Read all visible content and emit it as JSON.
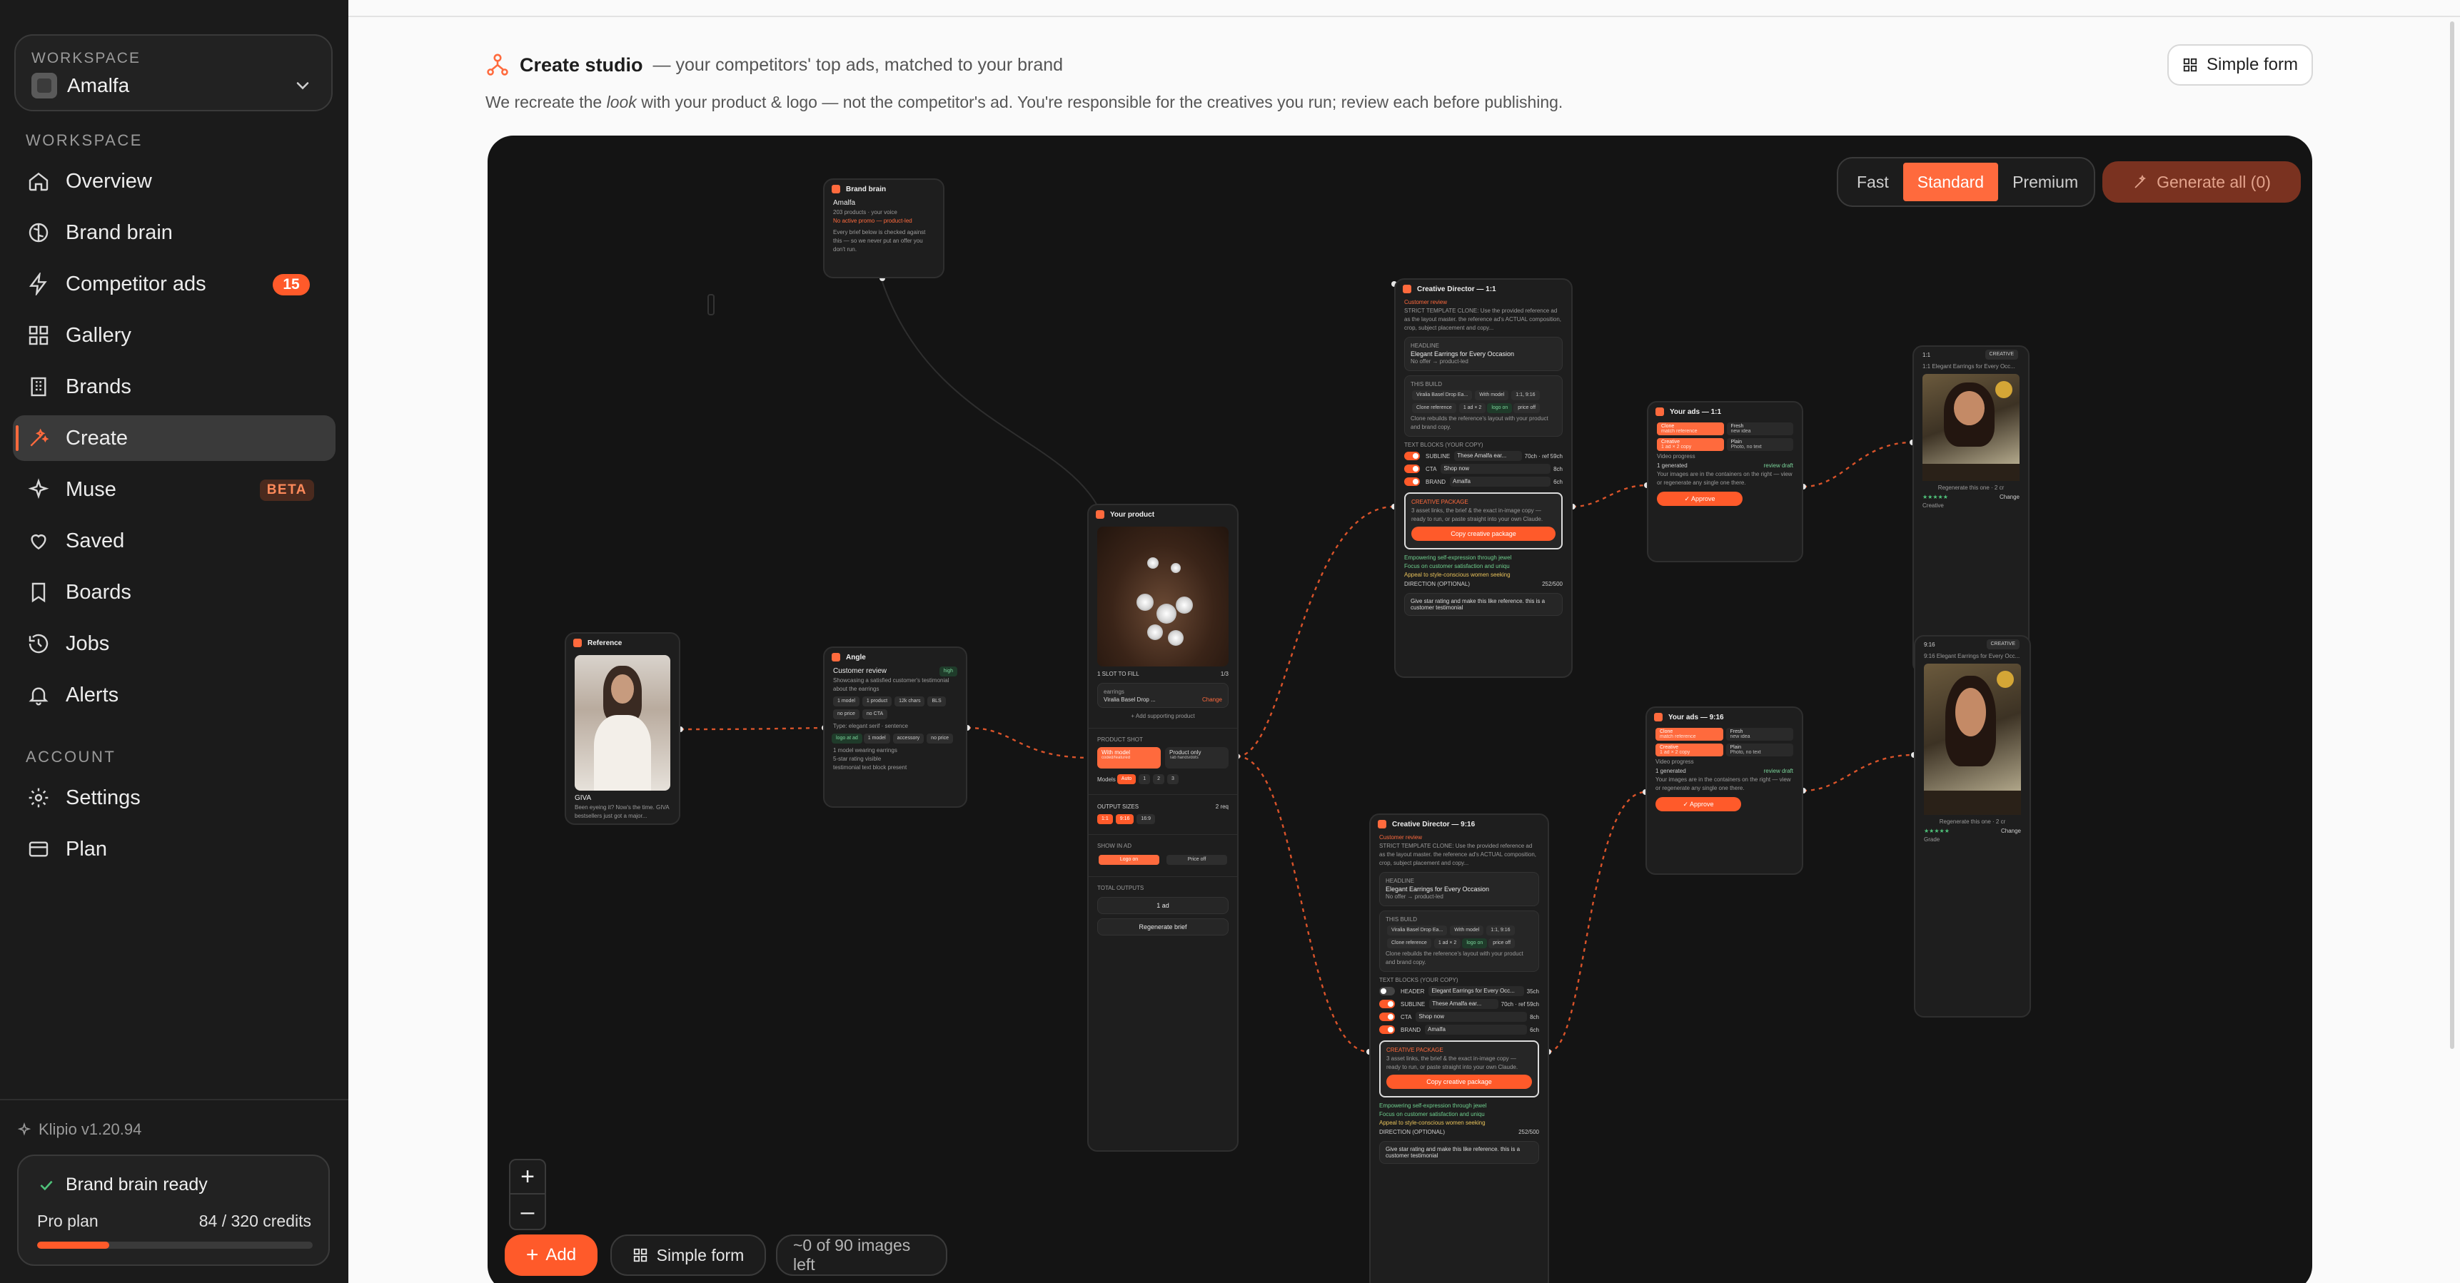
{
  "sidebar": {
    "workspace_caption": "WORKSPACE",
    "workspace_name": "Amalfa",
    "section_workspace": "WORKSPACE",
    "section_account": "ACCOUNT",
    "items": [
      {
        "label": "Overview",
        "icon": "home-icon"
      },
      {
        "label": "Brand brain",
        "icon": "brain-icon"
      },
      {
        "label": "Competitor ads",
        "icon": "bolt-icon",
        "count": "15"
      },
      {
        "label": "Gallery",
        "icon": "grid-icon"
      },
      {
        "label": "Brands",
        "icon": "building-icon"
      },
      {
        "label": "Create",
        "icon": "wand-icon",
        "active": true
      },
      {
        "label": "Muse",
        "icon": "sparkle-icon",
        "badge": "BETA"
      },
      {
        "label": "Saved",
        "icon": "heart-icon"
      },
      {
        "label": "Boards",
        "icon": "bookmark-icon"
      },
      {
        "label": "Jobs",
        "icon": "history-icon"
      },
      {
        "label": "Alerts",
        "icon": "bell-icon"
      }
    ],
    "account_items": [
      {
        "label": "Settings",
        "icon": "gear-icon"
      },
      {
        "label": "Plan",
        "icon": "card-icon"
      }
    ],
    "version": "Klipio v1.20.94",
    "status": "Brand brain ready",
    "plan": "Pro plan",
    "credits": "84 / 320 credits",
    "credits_used_fraction": 0.2625
  },
  "header": {
    "title": "Create studio",
    "subtitle": "— your competitors' top ads, matched to your brand",
    "desc_before": "We recreate the ",
    "desc_em": "look",
    "desc_after": " with your product & logo — not the competitor's ad. You're responsible for the creatives you run; review each before publishing.",
    "simple_form": "Simple form"
  },
  "canvas": {
    "tiers": [
      "Fast",
      "Standard",
      "Premium"
    ],
    "active_tier": "Standard",
    "generate_all": "Generate all (0)",
    "zoom_in": "+",
    "zoom_out": "–",
    "add": "Add",
    "simple_form": "Simple form",
    "images_left": "~0 of 90 images left"
  },
  "nodes": {
    "brand_brain": {
      "title": "Brand brain",
      "name": "Amalfa",
      "meta": "203 products · your voice",
      "warn": "No active promo — product-led",
      "body": "Every brief below is checked against this — so we never put an offer you don't run."
    },
    "reference": {
      "title": "Reference",
      "brand": "GIVA",
      "caption": "Been eyeing it? Now's the time. GIVA bestsellers just got a major..."
    },
    "angle": {
      "title": "Angle",
      "heading": "Customer review",
      "tag": "high",
      "body": "Showcasing a satisfied customer's testimonial about the earrings",
      "chips": [
        "1 model",
        "1 product",
        "12k chars",
        "BLS",
        "no price",
        "no CTA"
      ],
      "type": "Type: elegant serif · sentence",
      "chips2": [
        "logo at ad",
        "1 model",
        "accessory",
        "no price"
      ],
      "bullets": [
        "1 model wearing earrings",
        "5-star rating visible",
        "testimonial text block present"
      ]
    },
    "product": {
      "title": "Your product",
      "slot_label": "1 SLOT TO FILL",
      "slot_count": "1/3",
      "slot_key": "earrings",
      "slot_item": "Viralia Basel Drop ...",
      "slot_change": "Change",
      "add_support": "+ Add supporting product",
      "shot_label": "PRODUCT SHOT",
      "shot_options": [
        "With model",
        "Product only"
      ],
      "shot_sub": [
        "coded/featured",
        "Tab hands/dots"
      ],
      "models_label": "Models",
      "models": [
        "Auto",
        "1",
        "2",
        "3"
      ],
      "sizes_label": "OUTPUT SIZES",
      "sizes_count": "2 req",
      "sizes": [
        "1:1",
        "9:16",
        "16:9"
      ],
      "show_label": "SHOW IN AD",
      "show_opts": [
        "Logo on",
        "Price off"
      ],
      "total_label": "TOTAL OUTPUTS",
      "total_value": "1 ad",
      "regen": "Regenerate brief"
    },
    "cd_square": {
      "title": "Creative Director — 1:1",
      "tag": "Customer review",
      "body": "STRICT TEMPLATE CLONE: Use the provided reference ad as the layout master. the reference ad's ACTUAL composition, crop, subject placement and copy...",
      "headline_label": "HEADLINE",
      "headline": "Elegant Earrings for Every Occasion",
      "no_offer": "No offer → product-led",
      "build_label": "THIS BUILD",
      "build_chips": [
        "Viralia Basel Drop Ea...",
        "With model",
        "1:1, 9:16",
        "Clone reference",
        "1 ad × 2",
        "logo on",
        "price off"
      ],
      "clone_note": "Clone rebuilds the reference's layout with your product and brand copy.",
      "text_label": "TEXT BLOCKS (YOUR COPY)",
      "text_rows": [
        {
          "key": "SUBLINE",
          "value": "These Amalfa ear...",
          "len": "70ch · ref 59ch"
        },
        {
          "key": "CTA",
          "value": "Shop now",
          "len": "8ch"
        },
        {
          "key": "BRAND",
          "value": "Amalfa",
          "len": "6ch"
        }
      ],
      "pkg_label": "CREATIVE PACKAGE",
      "pkg_body": "3 asset links, the brief & the exact in-image copy — ready to run, or paste straight into your own Claude.",
      "pkg_btn": "Copy creative package",
      "checks": [
        "Empowering self-expression through jewel",
        "Focus on customer satisfaction and uniqu",
        "Appeal to style-conscious women seeking"
      ],
      "dir_label": "DIRECTION (OPTIONAL)",
      "dir_count": "252/500",
      "dir_text": "Give star rating and make this like reference. this is a customer testimonial"
    },
    "cd_story": {
      "title": "Creative Director — 9:16",
      "tag": "Customer review",
      "body": "STRICT TEMPLATE CLONE: Use the provided reference ad as the layout master. the reference ad's ACTUAL composition, crop, subject placement and copy...",
      "headline_label": "HEADLINE",
      "headline": "Elegant Earrings for Every Occasion",
      "no_offer": "No offer → product-led",
      "build_label": "THIS BUILD",
      "build_chips": [
        "Viralia Basel Drop Ea...",
        "With model",
        "1:1, 9:16",
        "Clone reference",
        "1 ad × 2",
        "logo on",
        "price off"
      ],
      "clone_note": "Clone rebuilds the reference's layout with your product and brand copy.",
      "text_label": "TEXT BLOCKS (YOUR COPY)",
      "text_rows": [
        {
          "key": "HEADER",
          "value": "Elegant Earrings for Every Occ...",
          "len": "35ch"
        },
        {
          "key": "SUBLINE",
          "value": "These Amalfa ear...",
          "len": "70ch · ref 59ch"
        },
        {
          "key": "CTA",
          "value": "Shop now",
          "len": "8ch"
        },
        {
          "key": "BRAND",
          "value": "Amalfa",
          "len": "6ch"
        }
      ],
      "pkg_label": "CREATIVE PACKAGE",
      "pkg_body": "3 asset links, the brief & the exact in-image copy — ready to run, or paste straight into your own Claude.",
      "pkg_btn": "Copy creative package",
      "checks": [
        "Empowering self-expression through jewel",
        "Focus on customer satisfaction and uniqu",
        "Appeal to style-conscious women seeking"
      ],
      "dir_label": "DIRECTION (OPTIONAL)",
      "dir_count": "252/500",
      "dir_text": "Give star rating and make this like reference. this is a customer testimonial"
    },
    "ads_square": {
      "title": "Your ads — 1:1",
      "opts": [
        [
          "Clone",
          "match reference"
        ],
        [
          "Fresh",
          "new idea"
        ],
        [
          "Creative",
          "1 ad × 2 copy"
        ],
        [
          "Plain",
          "Photo, no text"
        ]
      ],
      "progress": "Video progress",
      "gen": "1 generated",
      "review": "review draft",
      "note": "Your images are in the containers on the right — view or regenerate any single one there.",
      "approve": "✓ Approve"
    },
    "ads_story": {
      "title": "Your ads — 9:16",
      "opts": [
        [
          "Clone",
          "match reference"
        ],
        [
          "Fresh",
          "new idea"
        ],
        [
          "Creative",
          "1 ad × 2 copy"
        ],
        [
          "Plain",
          "Photo, no text"
        ]
      ],
      "progress": "Video progress",
      "gen": "1 generated",
      "review": "review draft",
      "note": "Your images are in the containers on the right — view or regenerate any single one there.",
      "approve": "✓ Approve"
    },
    "out_square": {
      "size": "1:1",
      "tag": "CREATIVE",
      "caption": "1:1 Elegant Earrings for Every Occ...",
      "regen": "Regenerate this one · 2 cr",
      "rating": "★★★★★",
      "change": "Change",
      "label": "Creative"
    },
    "out_story": {
      "size": "9:16",
      "tag": "CREATIVE",
      "caption": "9:16 Elegant Earrings for Every Occ...",
      "regen": "Regenerate this one · 2 cr",
      "rating": "★★★★★",
      "change": "Change",
      "label": "Grade"
    }
  },
  "colors": {
    "accent": "#ff5a2a",
    "sidebar_bg": "#1b1b1b",
    "canvas_bg": "#141414"
  }
}
